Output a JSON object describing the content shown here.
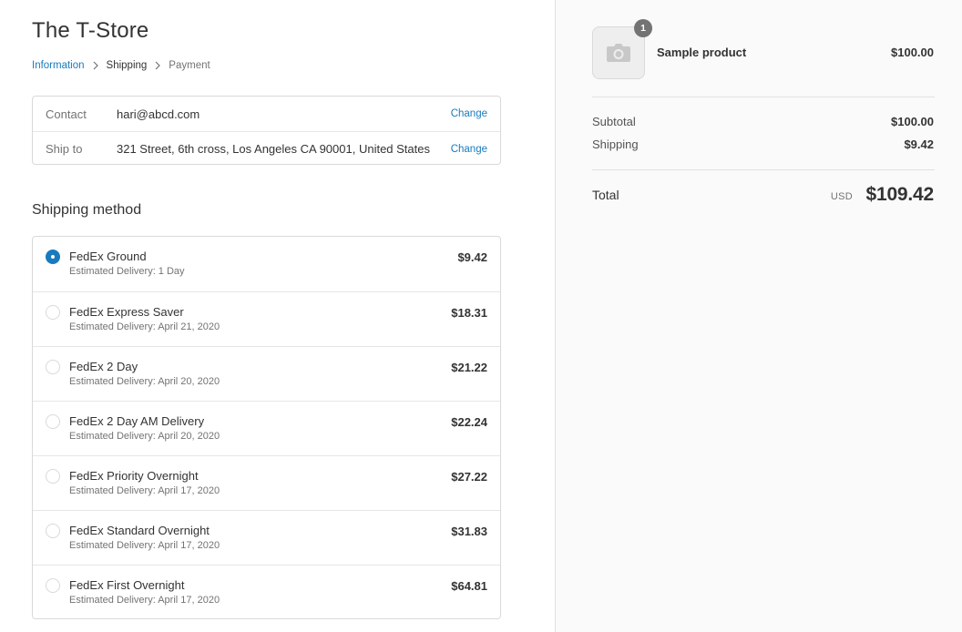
{
  "store": {
    "title": "The T-Store"
  },
  "breadcrumb": {
    "items": [
      {
        "label": "Information",
        "state": "link"
      },
      {
        "label": "Shipping",
        "state": "current"
      },
      {
        "label": "Payment",
        "state": "upcoming"
      }
    ]
  },
  "review": {
    "contact": {
      "label": "Contact",
      "value": "hari@abcd.com",
      "action": "Change"
    },
    "ship_to": {
      "label": "Ship to",
      "value": "321 Street, 6th cross, Los Angeles CA 90001, United States",
      "action": "Change"
    }
  },
  "shipping": {
    "title": "Shipping method",
    "methods": [
      {
        "name": "FedEx Ground",
        "eta": "Estimated Delivery: 1 Day",
        "price": "$9.42",
        "selected": true
      },
      {
        "name": "FedEx Express Saver",
        "eta": "Estimated Delivery: April 21, 2020",
        "price": "$18.31",
        "selected": false
      },
      {
        "name": "FedEx 2 Day",
        "eta": "Estimated Delivery: April 20, 2020",
        "price": "$21.22",
        "selected": false
      },
      {
        "name": "FedEx 2 Day AM Delivery",
        "eta": "Estimated Delivery: April 20, 2020",
        "price": "$22.24",
        "selected": false
      },
      {
        "name": "FedEx Priority Overnight",
        "eta": "Estimated Delivery: April 17, 2020",
        "price": "$27.22",
        "selected": false
      },
      {
        "name": "FedEx Standard Overnight",
        "eta": "Estimated Delivery: April 17, 2020",
        "price": "$31.83",
        "selected": false
      },
      {
        "name": "FedEx First Overnight",
        "eta": "Estimated Delivery: April 17, 2020",
        "price": "$64.81",
        "selected": false
      }
    ]
  },
  "summary": {
    "product": {
      "name": "Sample product",
      "price": "$100.00",
      "quantity": "1",
      "icon": "camera-icon"
    },
    "subtotal": {
      "label": "Subtotal",
      "value": "$100.00"
    },
    "shipping": {
      "label": "Shipping",
      "value": "$9.42"
    },
    "total": {
      "label": "Total",
      "currency": "USD",
      "value": "$109.42"
    }
  },
  "colors": {
    "accent": "#197bbd",
    "text": "#333333",
    "muted": "#737373",
    "border": "#d9d9d9",
    "sidebar_bg": "#fafafa"
  }
}
